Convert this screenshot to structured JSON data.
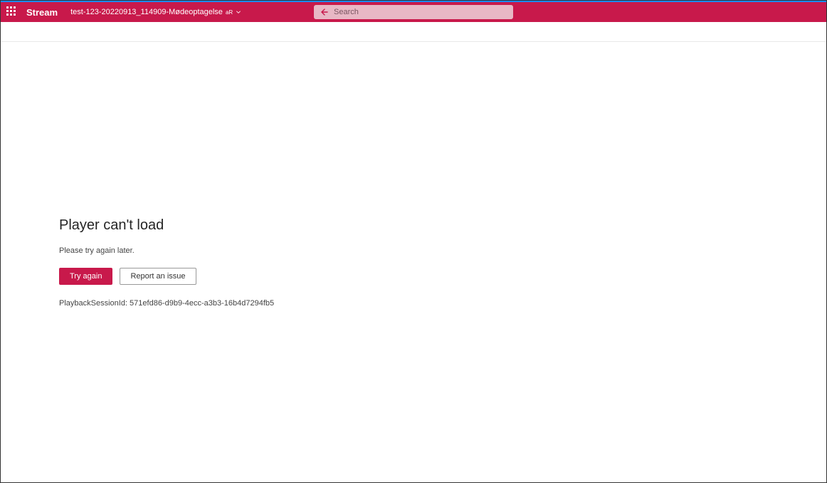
{
  "header": {
    "app_title": "Stream",
    "file_name": "test-123-20220913_114909-Mødeoptagelse",
    "file_badge": "aR"
  },
  "search": {
    "placeholder": "Search"
  },
  "error": {
    "title": "Player can't load",
    "subtitle": "Please try again later.",
    "try_again_label": "Try again",
    "report_issue_label": "Report an issue",
    "session_id": "PlaybackSessionId: 571efd86-d9b9-4ecc-a3b3-16b4d7294fb5"
  },
  "colors": {
    "brand": "#c8194b",
    "accent": "#1a8cff"
  }
}
